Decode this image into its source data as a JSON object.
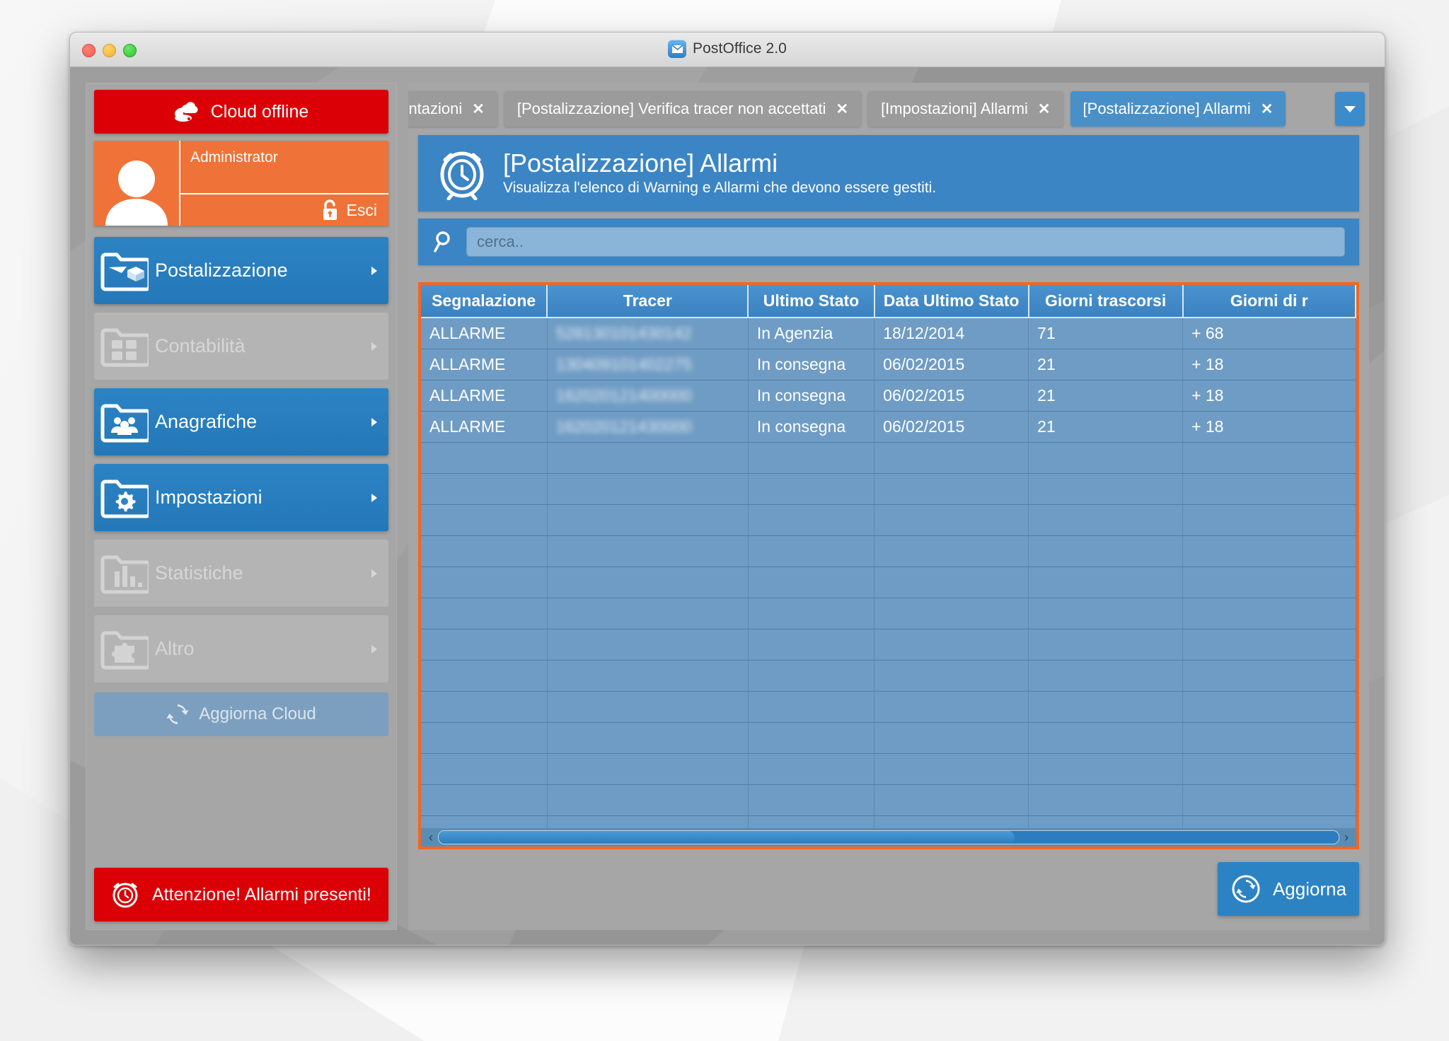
{
  "window": {
    "title": "PostOffice 2.0",
    "app_icon": "envelope-icon",
    "traffic_lights": [
      "close",
      "minimize",
      "zoom"
    ]
  },
  "sidebar": {
    "cloud_status": {
      "label": "Cloud offline",
      "icon": "cloud-offline-icon",
      "color": "#da0005"
    },
    "user": {
      "name": "",
      "role": "Administrator",
      "logout_label": "Esci",
      "logout_icon": "unlock-icon",
      "avatar_icon": "user-avatar-icon"
    },
    "menu": [
      {
        "label": "Postalizzazione",
        "icon": "mail-package-folder-icon",
        "enabled": true
      },
      {
        "label": "Contabilità",
        "icon": "calculator-folder-icon",
        "enabled": false
      },
      {
        "label": "Anagrafiche",
        "icon": "people-folder-icon",
        "enabled": true
      },
      {
        "label": "Impostazioni",
        "icon": "gear-folder-icon",
        "enabled": true
      },
      {
        "label": "Statistiche",
        "icon": "chart-folder-icon",
        "enabled": false
      },
      {
        "label": "Altro",
        "icon": "puzzle-folder-icon",
        "enabled": false
      }
    ],
    "update_cloud": {
      "label": "Aggiorna Cloud",
      "icon": "refresh-icon"
    },
    "alarm_banner": {
      "label": "Attenzione! Allarmi presenti!",
      "icon": "alarm-clock-icon",
      "color": "#da0005"
    }
  },
  "tabs": {
    "items": [
      {
        "label": "vimentazioni",
        "close": "✕",
        "active": false,
        "clipped": true
      },
      {
        "label": "[Postalizzazione] Verifica tracer non accettati",
        "close": "✕",
        "active": false,
        "clipped": false
      },
      {
        "label": "[Impostazioni] Allarmi",
        "close": "✕",
        "active": false,
        "clipped": false
      },
      {
        "label": "[Postalizzazione] Allarmi",
        "close": "✕",
        "active": true,
        "clipped": false
      }
    ],
    "overflow_icon": "chevron-down-icon"
  },
  "page": {
    "icon": "alarm-clock-icon",
    "title": "[Postalizzazione] Allarmi",
    "subtitle": "Visualizza l'elenco di Warning e Allarmi che devono essere gestiti.",
    "accent": "#3c85c4"
  },
  "search": {
    "icon": "search-icon",
    "placeholder": "cerca..",
    "value": ""
  },
  "table": {
    "highlight_color": "#f26722",
    "columns": [
      "Segnalazione",
      "Tracer",
      "Ultimo Stato",
      "Data Ultimo Stato",
      "Giorni trascorsi",
      "Giorni di r"
    ],
    "rows": [
      {
        "segnalazione": "ALLARME",
        "tracer": "528130101430142",
        "tracer_redacted": true,
        "ultimo_stato": "In Agenzia",
        "data_ultimo_stato": "18/12/2014",
        "giorni_trascorsi": "71",
        "giorni_ritardo": "+ 68"
      },
      {
        "segnalazione": "ALLARME",
        "tracer": "130409101402275",
        "tracer_redacted": true,
        "ultimo_stato": "In consegna",
        "data_ultimo_stato": "06/02/2015",
        "giorni_trascorsi": "21",
        "giorni_ritardo": "+ 18"
      },
      {
        "segnalazione": "ALLARME",
        "tracer": "162020121400000",
        "tracer_redacted": true,
        "ultimo_stato": "In consegna",
        "data_ultimo_stato": "06/02/2015",
        "giorni_trascorsi": "21",
        "giorni_ritardo": "+ 18"
      },
      {
        "segnalazione": "ALLARME",
        "tracer": "162020121430000",
        "tracer_redacted": true,
        "ultimo_stato": "In consegna",
        "data_ultimo_stato": "06/02/2015",
        "giorni_trascorsi": "21",
        "giorni_ritardo": "+ 18"
      }
    ],
    "empty_rows": 14,
    "scrollbar": {
      "left_arrow": "‹",
      "right_arrow": "›",
      "thumb_percent": 64
    }
  },
  "footer": {
    "refresh_button": {
      "label": "Aggiorna",
      "icon": "refresh-circle-icon"
    }
  }
}
